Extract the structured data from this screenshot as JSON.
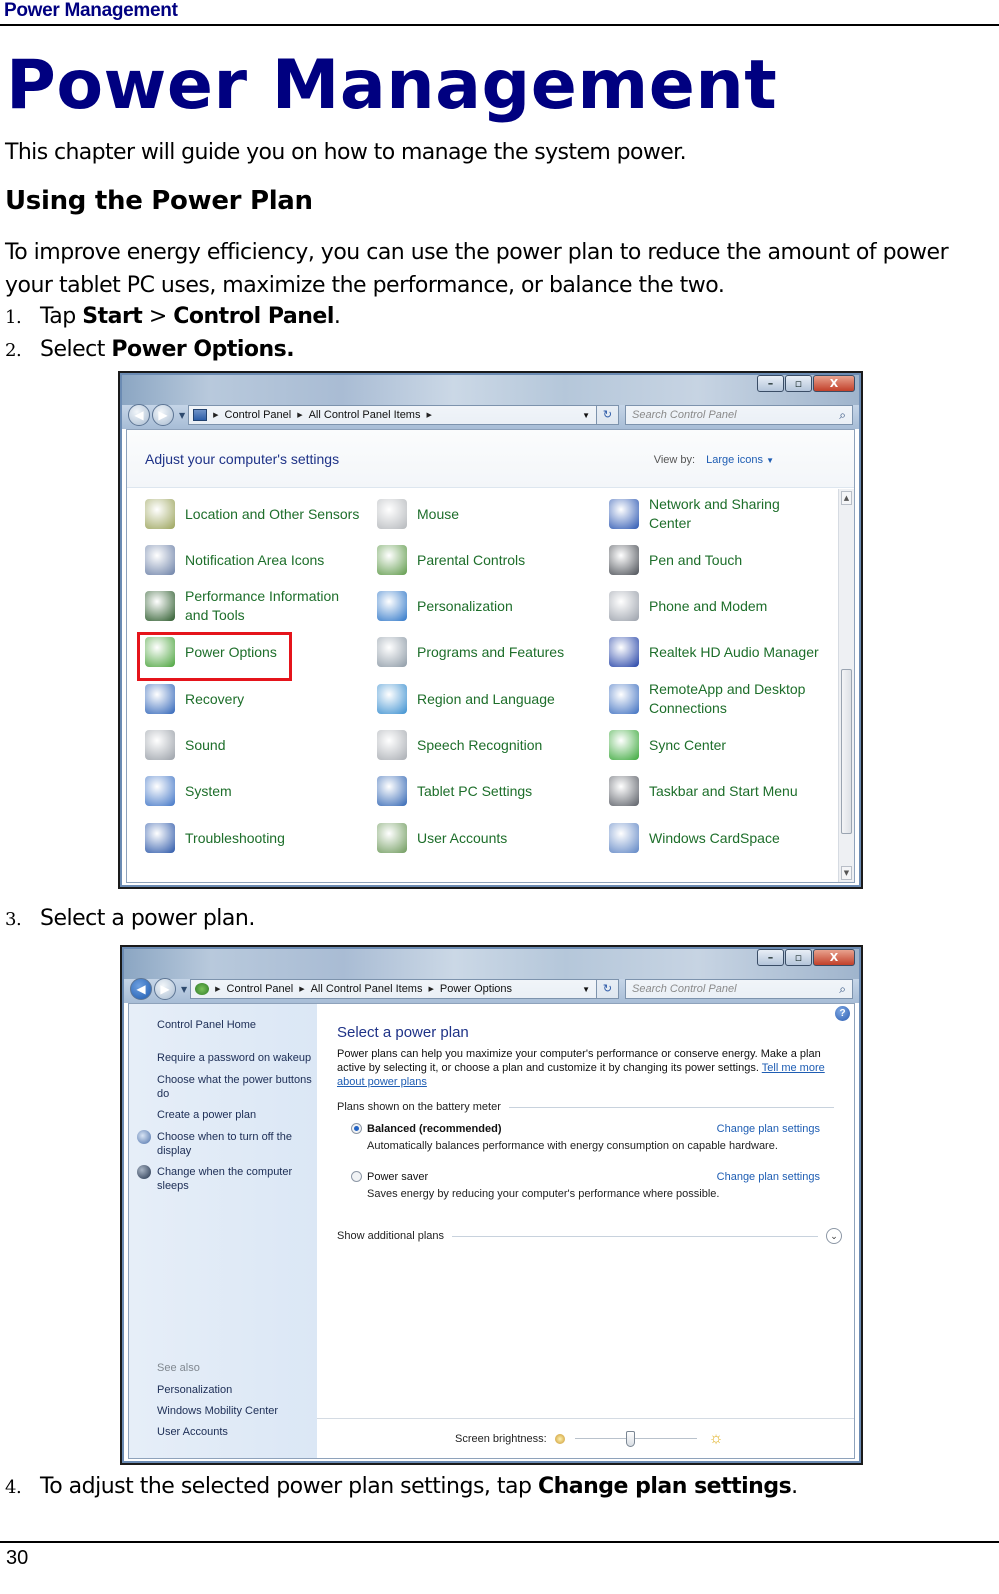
{
  "running_header": "Power Management",
  "chapter_title": "Power Management",
  "intro": "This chapter will guide you on how to manage the system power.",
  "section_heading": "Using the Power Plan",
  "paragraph": "To improve energy efficiency, you can use the power plan to reduce the amount of power your tablet PC uses, maximize the performance, or balance the two.",
  "steps": [
    {
      "num": "1.",
      "parts": [
        {
          "t": "Tap "
        },
        {
          "b": "Start"
        },
        {
          "t": " > "
        },
        {
          "b": "Control Panel"
        },
        {
          "t": "."
        }
      ]
    },
    {
      "num": "2.",
      "parts": [
        {
          "t": "Select "
        },
        {
          "b": "Power Options."
        }
      ]
    },
    {
      "num": "3.",
      "parts": [
        {
          "t": "Select a power plan."
        }
      ]
    },
    {
      "num": "4.",
      "parts": [
        {
          "t": "To adjust the selected power plan settings, tap "
        },
        {
          "b": "Change plan settings"
        },
        {
          "t": "."
        }
      ]
    }
  ],
  "screenshot1": {
    "breadcrumb": [
      "Control Panel",
      "All Control Panel Items"
    ],
    "search_placeholder": "Search Control Panel",
    "heading": "Adjust your computer's settings",
    "view_by_label": "View by:",
    "view_by_value": "Large icons",
    "highlighted_item": "Power Options",
    "columns": [
      [
        {
          "label": "Location and Other Sensors",
          "icon": "location-sensor-icon",
          "color": "#9aa35a"
        },
        {
          "label": "Notification Area Icons",
          "icon": "notification-area-icon",
          "color": "#6a7fa6"
        },
        {
          "label": "Performance Information and Tools",
          "icon": "performance-icon",
          "color": "#2b5a2b"
        },
        {
          "label": "Power Options",
          "icon": "battery-plug-icon",
          "color": "#49a33a"
        },
        {
          "label": "Recovery",
          "icon": "recovery-icon",
          "color": "#2f64b8"
        },
        {
          "label": "Sound",
          "icon": "speaker-icon",
          "color": "#9aa0a8"
        },
        {
          "label": "System",
          "icon": "system-icon",
          "color": "#3f74c6"
        },
        {
          "label": "Troubleshooting",
          "icon": "troubleshooting-icon",
          "color": "#2a56a8"
        }
      ],
      [
        {
          "label": "Mouse",
          "icon": "mouse-icon",
          "color": "#b5b8bc"
        },
        {
          "label": "Parental Controls",
          "icon": "parental-controls-icon",
          "color": "#5f9a4a"
        },
        {
          "label": "Personalization",
          "icon": "personalization-icon",
          "color": "#2e76c8"
        },
        {
          "label": "Programs and Features",
          "icon": "programs-features-icon",
          "color": "#8d9aa6"
        },
        {
          "label": "Region and Language",
          "icon": "globe-clock-icon",
          "color": "#3a8fd0"
        },
        {
          "label": "Speech Recognition",
          "icon": "microphone-icon",
          "color": "#a9adb3"
        },
        {
          "label": "Tablet PC Settings",
          "icon": "tablet-pen-icon",
          "color": "#3266b4"
        },
        {
          "label": "User Accounts",
          "icon": "user-accounts-icon",
          "color": "#6e9a5c"
        }
      ],
      [
        {
          "label": "Network and Sharing Center",
          "icon": "network-icon",
          "color": "#2a56b2"
        },
        {
          "label": "Pen and Touch",
          "icon": "pen-icon",
          "color": "#4a4e55"
        },
        {
          "label": "Phone and Modem",
          "icon": "phone-modem-icon",
          "color": "#9aa0aa"
        },
        {
          "label": "Realtek HD Audio Manager",
          "icon": "audio-wave-icon",
          "color": "#2140a6"
        },
        {
          "label": "RemoteApp and Desktop Connections",
          "icon": "remote-desktop-icon",
          "color": "#3c6ec0"
        },
        {
          "label": "Sync Center",
          "icon": "sync-icon",
          "color": "#3aa83a"
        },
        {
          "label": "Taskbar and Start Menu",
          "icon": "taskbar-icon",
          "color": "#5a5e66"
        },
        {
          "label": "Windows CardSpace",
          "icon": "cardspace-icon",
          "color": "#5d84c4"
        }
      ]
    ]
  },
  "screenshot2": {
    "breadcrumb": [
      "Control Panel",
      "All Control Panel Items",
      "Power Options"
    ],
    "search_placeholder": "Search Control Panel",
    "left_nav": {
      "home": "Control Panel Home",
      "links": [
        "Require a password on wakeup",
        "Choose what the power buttons do",
        "Create a power plan",
        "Choose when to turn off the display",
        "Change when the computer sleeps"
      ],
      "see_also_label": "See also",
      "see_also": [
        "Personalization",
        "Windows Mobility Center",
        "User Accounts"
      ]
    },
    "title": "Select a power plan",
    "description": "Power plans can help you maximize your computer's performance or conserve energy. Make a plan active by selecting it, or choose a plan and customize it by changing its power settings.",
    "description_link": "Tell me more about power plans",
    "group_label": "Plans shown on the battery meter",
    "plans": [
      {
        "name": "Balanced (recommended)",
        "selected": true,
        "link": "Change plan settings",
        "desc": "Automatically balances performance with energy consumption on capable hardware."
      },
      {
        "name": "Power saver",
        "selected": false,
        "link": "Change plan settings",
        "desc": "Saves energy by reducing your computer's performance where possible."
      }
    ],
    "show_additional": "Show additional plans",
    "brightness_label": "Screen brightness:",
    "brightness_fraction": 0.45
  },
  "window_buttons": {
    "minimize": "–",
    "maximize": "▫",
    "close": "X"
  },
  "page_number": "30"
}
